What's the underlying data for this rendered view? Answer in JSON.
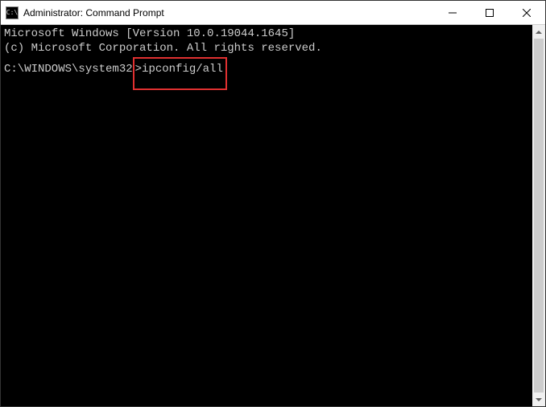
{
  "window": {
    "title": "Administrator: Command Prompt",
    "icon_glyph": "C:\\"
  },
  "terminal": {
    "line1": "Microsoft Windows [Version 10.0.19044.1645]",
    "line2": "(c) Microsoft Corporation. All rights reserved.",
    "blank": "",
    "prompt_path": "C:\\WINDOWS\\system32",
    "prompt_sep": ">",
    "command": "ipconfig/all"
  }
}
